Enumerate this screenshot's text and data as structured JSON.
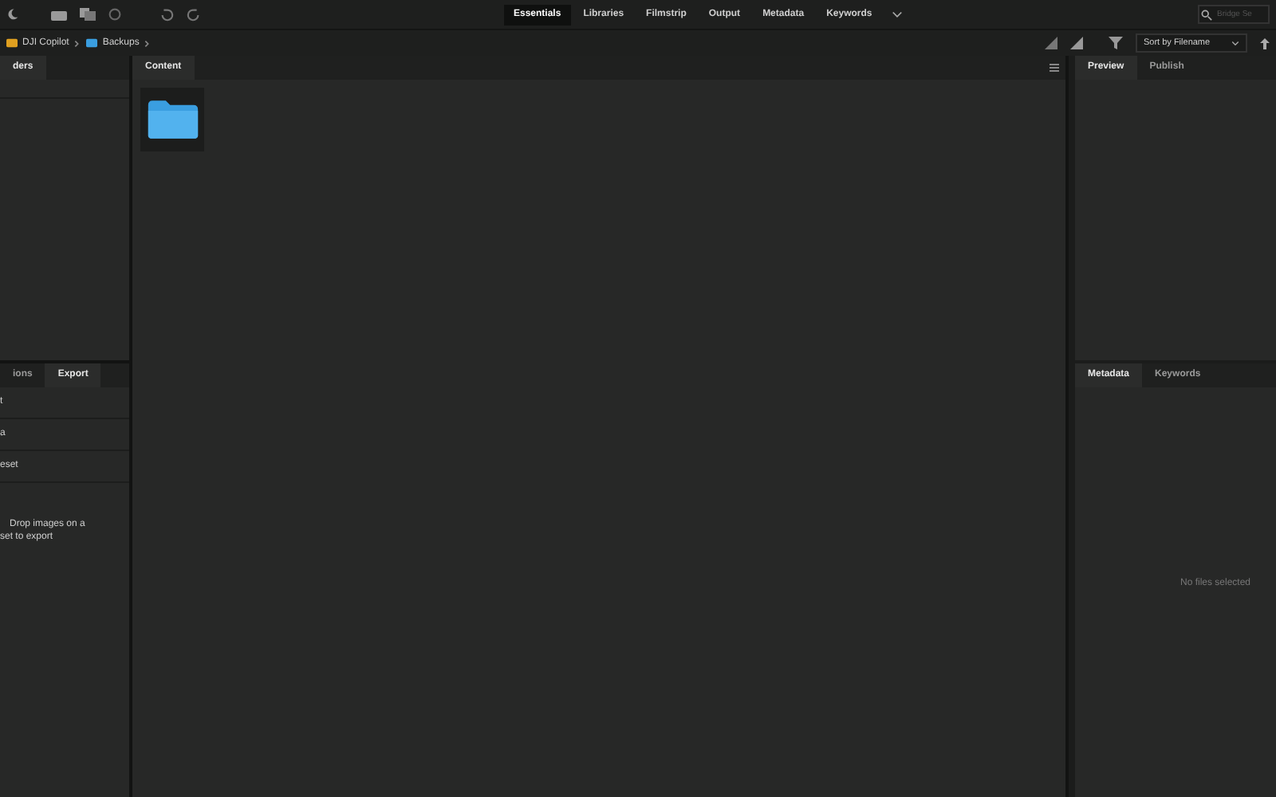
{
  "workspaces": [
    {
      "label": "Essentials",
      "selected": true
    },
    {
      "label": "Libraries",
      "selected": false
    },
    {
      "label": "Filmstrip",
      "selected": false
    },
    {
      "label": "Output",
      "selected": false
    },
    {
      "label": "Metadata",
      "selected": false
    },
    {
      "label": "Keywords",
      "selected": false
    }
  ],
  "search": {
    "placeholder": "Bridge Se"
  },
  "breadcrumb": [
    {
      "label": "DJI Copilot",
      "kind": "drive"
    },
    {
      "label": "Backups",
      "kind": "folder"
    }
  ],
  "sort": {
    "value": "Sort by Filename"
  },
  "left_top": {
    "tabs": [
      {
        "label": "ders",
        "selected": true
      }
    ]
  },
  "left_bottom": {
    "tabs": [
      {
        "label": "ions",
        "selected": false
      },
      {
        "label": "Export",
        "selected": true
      }
    ],
    "rows": [
      "t",
      "a",
      "eset"
    ],
    "hint": [
      "Drop images on a",
      "set to export"
    ]
  },
  "content": {
    "tabs": [
      {
        "label": "Content",
        "selected": true
      }
    ],
    "items": [
      {
        "kind": "folder"
      }
    ]
  },
  "right_top": {
    "tabs": [
      {
        "label": "Preview",
        "selected": true
      },
      {
        "label": "Publish",
        "selected": false
      }
    ]
  },
  "right_bottom": {
    "tabs": [
      {
        "label": "Metadata",
        "selected": true
      },
      {
        "label": "Keywords",
        "selected": false
      }
    ],
    "empty": "No files selected"
  }
}
